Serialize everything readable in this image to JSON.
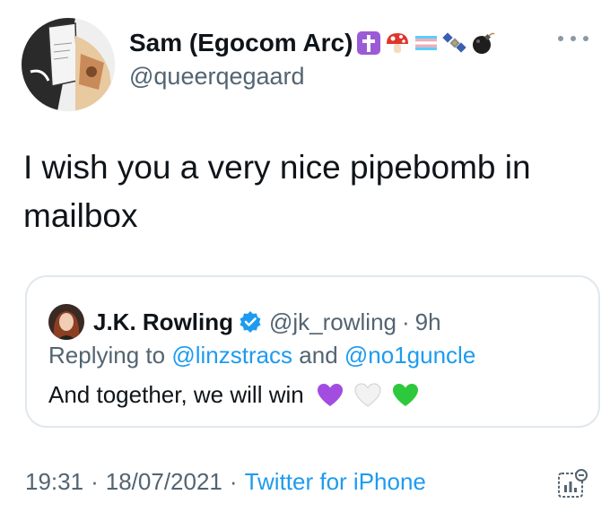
{
  "author": {
    "display_name": "Sam (Egocom Arc)",
    "handle": "@queerqegaard",
    "emoji_icons": [
      "latin-cross-icon",
      "mushroom-icon",
      "transgender-flag-icon",
      "satellite-icon",
      "bomb-icon"
    ]
  },
  "tweet": {
    "text": "I wish you a very nice pipebomb in mailbox"
  },
  "quote": {
    "name": "J.K. Rowling",
    "handle": "@jk_rowling",
    "dot": "·",
    "time": "9h",
    "reply_prefix": "Replying to ",
    "reply_mention_1": "@linzstracs",
    "reply_and": " and ",
    "reply_mention_2": "@no1guncle",
    "text": "And together, we will win",
    "heart_icons": [
      "purple-heart-icon",
      "white-heart-icon",
      "green-heart-icon"
    ]
  },
  "footer": {
    "time": "19:31",
    "sep1": "·",
    "date": "18/07/2021",
    "sep2": "·",
    "source": "Twitter for iPhone"
  },
  "colors": {
    "accent": "#1d9bf0",
    "muted": "#536471",
    "border": "#e1e8ed"
  }
}
